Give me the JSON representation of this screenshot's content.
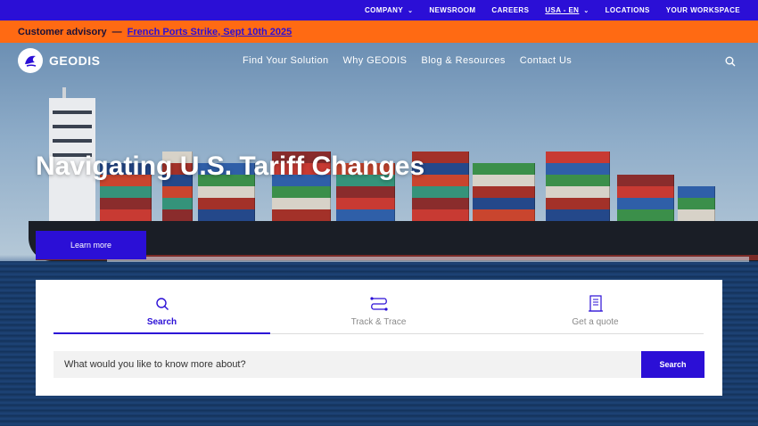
{
  "topbar": {
    "items": [
      {
        "label": "COMPANY",
        "chevron": true
      },
      {
        "label": "NEWSROOM",
        "chevron": false
      },
      {
        "label": "CAREERS",
        "chevron": false
      },
      {
        "label": "USA - EN",
        "chevron": true,
        "underlined": true
      },
      {
        "label": "LOCATIONS",
        "chevron": false
      },
      {
        "label": "YOUR WORKSPACE",
        "chevron": false
      }
    ],
    "background": "#2b0fd6"
  },
  "advisory": {
    "label": "Customer advisory",
    "dash": "—",
    "link_text": "French Ports Strike, Sept 10th 2025",
    "background": "#ff6a13"
  },
  "header": {
    "logo_text": "GEODIS",
    "menu": [
      "Find Your Solution",
      "Why GEODIS",
      "Blog & Resources",
      "Contact Us"
    ],
    "search_icon": "search-icon"
  },
  "hero": {
    "headline": "Navigating U.S. Tariff Changes",
    "cta_label": "Learn more"
  },
  "search_card": {
    "tabs": [
      {
        "label": "Search",
        "icon": "search-icon",
        "active": true
      },
      {
        "label": "Track & Trace",
        "icon": "route-icon",
        "active": false
      },
      {
        "label": "Get a quote",
        "icon": "document-icon",
        "active": false
      }
    ],
    "input_placeholder": "What would you like to know more about?",
    "button_label": "Search"
  },
  "colors": {
    "accent": "#2b0fd6",
    "advisory": "#ff6a13"
  }
}
